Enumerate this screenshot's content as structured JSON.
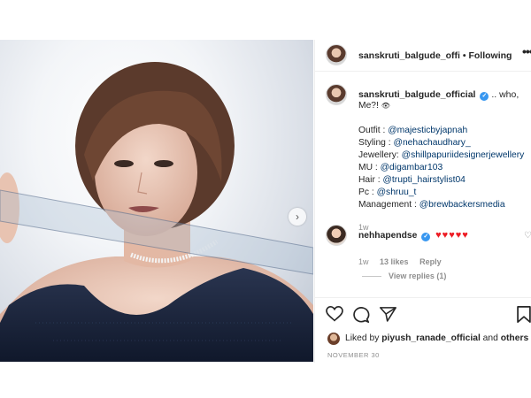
{
  "post": {
    "header": {
      "username": "sanskruti_balgude_offi",
      "separator": "•",
      "follow_status": "Following",
      "more": "•••"
    },
    "caption": {
      "username": "sanskruti_balgude_official",
      "text": ".. who,",
      "text2": "Me?!",
      "emoji": "👁",
      "credits": [
        {
          "label": "Outfit : ",
          "mention": "@majesticbyjapnah"
        },
        {
          "label": "Styling : ",
          "mention": "@nehachaudhary_"
        },
        {
          "label": "Jewellery: ",
          "mention": "@shillpapuriidesignerjewellery"
        },
        {
          "label": "MU : ",
          "mention": "@digambar103"
        },
        {
          "label": "Hair : ",
          "mention": "@trupti_hairstylist04"
        },
        {
          "label": "Pc : ",
          "mention": "@shruu_t"
        },
        {
          "label": "Management : ",
          "mention": "@brewbackersmedia"
        }
      ],
      "time": "1w"
    },
    "comment": {
      "username": "nehhapendse",
      "text": "♥♥♥♥♥",
      "time": "1w",
      "likes": "13 likes",
      "reply": "Reply",
      "view_replies": "View replies (1)"
    },
    "likes": {
      "prefix": "Liked by ",
      "user": "piyush_ranade_official",
      "middle": " and ",
      "others": "others"
    },
    "date": "NOVEMBER 30",
    "colors": {
      "verified": "#3897f0",
      "mention": "#00376b",
      "heart": "#ed1c24",
      "muted": "#8e8e8e"
    },
    "icons": [
      "heart-icon",
      "comment-icon",
      "share-icon",
      "save-icon",
      "chevron-right-icon",
      "verified-icon",
      "eye-icon"
    ]
  }
}
